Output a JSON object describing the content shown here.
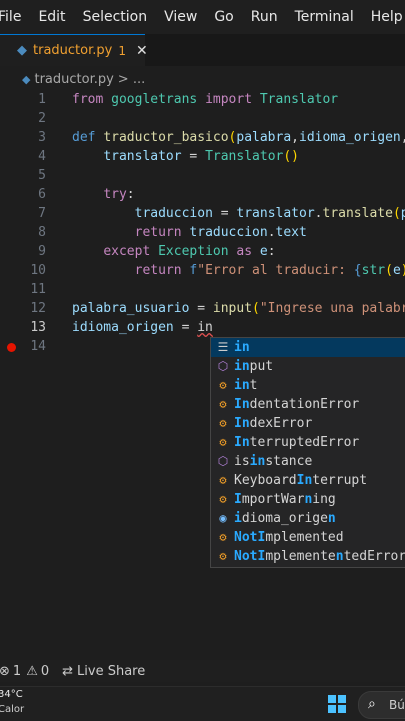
{
  "menu": [
    "File",
    "Edit",
    "Selection",
    "View",
    "Go",
    "Run",
    "Terminal",
    "Help"
  ],
  "tab": {
    "file": "traductor.py",
    "problems": "1",
    "close": "✕"
  },
  "breadcrumb": {
    "file": "traductor.py",
    "more": "> ..."
  },
  "lines": [
    {
      "n": "1",
      "segs": [
        [
          "from",
          "ctl"
        ],
        [
          " ",
          ""
        ],
        [
          "googletrans",
          "cls"
        ],
        [
          " ",
          ""
        ],
        [
          "import",
          "ctl"
        ],
        [
          " ",
          ""
        ],
        [
          "Translator",
          "cls"
        ]
      ]
    },
    {
      "n": "2",
      "segs": []
    },
    {
      "n": "3",
      "segs": [
        [
          "def",
          "kw"
        ],
        [
          " ",
          ""
        ],
        [
          "traductor_basico",
          "fn"
        ],
        [
          "(",
          "br"
        ],
        [
          "palabra",
          "var"
        ],
        [
          ",",
          "pl"
        ],
        [
          "idioma_origen",
          "var"
        ],
        [
          ",i",
          "pl"
        ]
      ]
    },
    {
      "n": "4",
      "segs": [
        [
          "    ",
          ""
        ],
        [
          "translator",
          "var"
        ],
        [
          " = ",
          "pl"
        ],
        [
          "Translator",
          "cls"
        ],
        [
          "()",
          "br"
        ]
      ]
    },
    {
      "n": "5",
      "segs": []
    },
    {
      "n": "6",
      "segs": [
        [
          "    ",
          ""
        ],
        [
          "try",
          "ctl"
        ],
        [
          ":",
          "pl"
        ]
      ]
    },
    {
      "n": "7",
      "segs": [
        [
          "        ",
          ""
        ],
        [
          "traduccion",
          "var"
        ],
        [
          " = ",
          "pl"
        ],
        [
          "translator",
          "var"
        ],
        [
          ".",
          "pl"
        ],
        [
          "translate",
          "fn"
        ],
        [
          "(",
          "br"
        ],
        [
          "pa",
          "var"
        ]
      ]
    },
    {
      "n": "8",
      "segs": [
        [
          "        ",
          ""
        ],
        [
          "return",
          "ctl"
        ],
        [
          " ",
          ""
        ],
        [
          "traduccion",
          "var"
        ],
        [
          ".",
          "pl"
        ],
        [
          "text",
          "var"
        ]
      ]
    },
    {
      "n": "9",
      "segs": [
        [
          "    ",
          ""
        ],
        [
          "except",
          "ctl"
        ],
        [
          " ",
          ""
        ],
        [
          "Exception",
          "cls"
        ],
        [
          " ",
          ""
        ],
        [
          "as",
          "ctl"
        ],
        [
          " ",
          ""
        ],
        [
          "e",
          "var"
        ],
        [
          ":",
          "pl"
        ]
      ]
    },
    {
      "n": "10",
      "segs": [
        [
          "        ",
          ""
        ],
        [
          "return",
          "ctl"
        ],
        [
          " ",
          ""
        ],
        [
          "f",
          "kw"
        ],
        [
          "\"Error al traducir: ",
          "str"
        ],
        [
          "{",
          "kw"
        ],
        [
          "str",
          "cls"
        ],
        [
          "(",
          "br"
        ],
        [
          "e",
          "var"
        ],
        [
          "))",
          "br"
        ]
      ]
    },
    {
      "n": "11",
      "segs": []
    },
    {
      "n": "12",
      "segs": [
        [
          "palabra_usuario",
          "var"
        ],
        [
          " = ",
          "pl"
        ],
        [
          "input",
          "fn"
        ],
        [
          "(",
          "br"
        ],
        [
          "\"Ingrese una palabra",
          "str"
        ]
      ]
    },
    {
      "n": "13",
      "segs": [
        [
          "idioma_origen",
          "var"
        ],
        [
          " = ",
          "pl"
        ],
        [
          "in",
          "typed"
        ]
      ]
    },
    {
      "n": "14",
      "segs": []
    }
  ],
  "suggestions": [
    {
      "kind": "kw",
      "icon": "☰",
      "parts": [
        [
          "in",
          "hl"
        ]
      ]
    },
    {
      "kind": "fn",
      "icon": "⬡",
      "parts": [
        [
          "in",
          "hl"
        ],
        [
          "put",
          ""
        ]
      ]
    },
    {
      "kind": "cls",
      "icon": "⚙",
      "parts": [
        [
          "in",
          "hl"
        ],
        [
          "t",
          ""
        ]
      ]
    },
    {
      "kind": "cls",
      "icon": "⚙",
      "parts": [
        [
          "In",
          "hl"
        ],
        [
          "dentationError",
          ""
        ]
      ]
    },
    {
      "kind": "cls",
      "icon": "⚙",
      "parts": [
        [
          "In",
          "hl"
        ],
        [
          "dexError",
          ""
        ]
      ]
    },
    {
      "kind": "cls",
      "icon": "⚙",
      "parts": [
        [
          "In",
          "hl"
        ],
        [
          "terruptedError",
          ""
        ]
      ]
    },
    {
      "kind": "fn",
      "icon": "⬡",
      "parts": [
        [
          "is",
          ""
        ],
        [
          "in",
          "hl"
        ],
        [
          "stance",
          ""
        ]
      ]
    },
    {
      "kind": "cls",
      "icon": "⚙",
      "parts": [
        [
          "Keyboard",
          ""
        ],
        [
          "In",
          "hl"
        ],
        [
          "terrupt",
          ""
        ]
      ]
    },
    {
      "kind": "cls",
      "icon": "⚙",
      "parts": [
        [
          "I",
          "hl"
        ],
        [
          "mportWar",
          ""
        ],
        [
          "n",
          "hl"
        ],
        [
          "ing",
          ""
        ]
      ]
    },
    {
      "kind": "var",
      "icon": "◉",
      "parts": [
        [
          "i",
          "hl"
        ],
        [
          "dioma_orige",
          ""
        ],
        [
          "n",
          "hl"
        ]
      ]
    },
    {
      "kind": "cls",
      "icon": "⚙",
      "parts": [
        [
          "NotI",
          "hl"
        ],
        [
          "mplemented",
          ""
        ]
      ]
    },
    {
      "kind": "cls",
      "icon": "⚙",
      "parts": [
        [
          "NotI",
          "hl"
        ],
        [
          "mplemente",
          ""
        ],
        [
          "n",
          "hl"
        ],
        [
          "tedError",
          ""
        ]
      ]
    }
  ],
  "status": {
    "errors": "1",
    "warnings": "0",
    "live_share": "Live Share"
  },
  "taskbar": {
    "temp": "34°C",
    "cond": "Calor",
    "search": "Bús"
  },
  "colors": {
    "accent": "#0078d4",
    "breakpoint": "#e51400",
    "highlight": "#2aaaff"
  }
}
